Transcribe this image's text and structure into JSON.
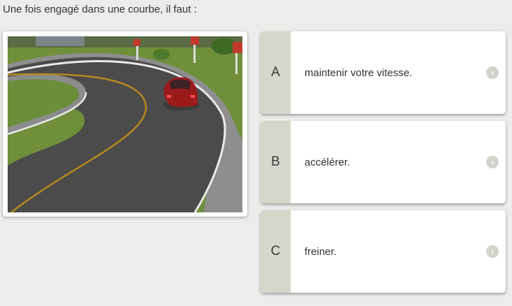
{
  "question": "Une fois engagé dans une courbe, il faut :",
  "answers": [
    {
      "letter": "A",
      "text": "maintenir votre vitesse."
    },
    {
      "letter": "B",
      "text": "accélérer."
    },
    {
      "letter": "C",
      "text": "freiner."
    }
  ],
  "icons": {
    "answer_arrow": "chevron-right-icon"
  },
  "colors": {
    "letter_column": "#d6d6cd",
    "background": "#ececea"
  }
}
